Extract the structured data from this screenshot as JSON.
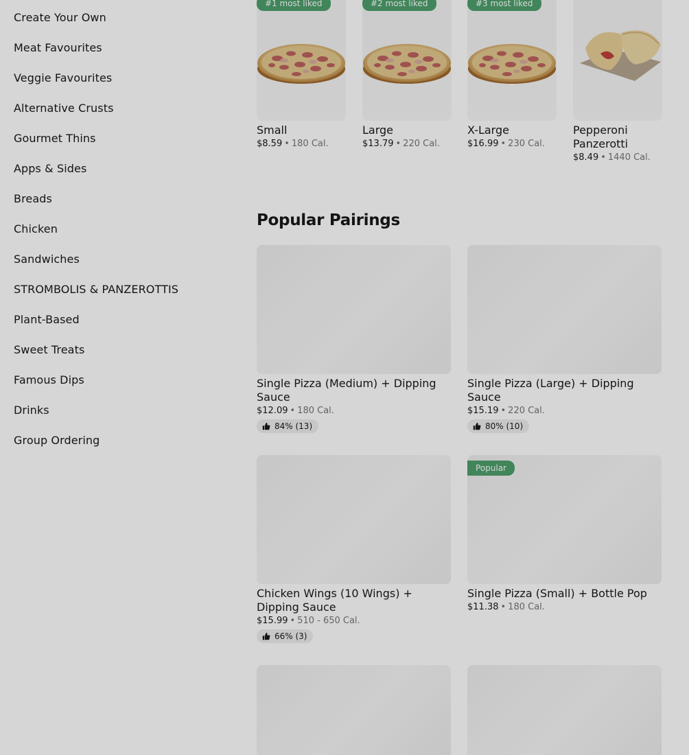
{
  "sidebar": {
    "items": [
      {
        "label": "Create Your Own"
      },
      {
        "label": "Meat Favourites"
      },
      {
        "label": "Veggie Favourites"
      },
      {
        "label": "Alternative Crusts"
      },
      {
        "label": "Gourmet Thins"
      },
      {
        "label": "Apps & Sides"
      },
      {
        "label": "Breads"
      },
      {
        "label": "Chicken"
      },
      {
        "label": "Sandwiches"
      },
      {
        "label": "STROMBOLIS & PANZEROTTIS"
      },
      {
        "label": "Plant-Based"
      },
      {
        "label": "Sweet Treats"
      },
      {
        "label": "Famous Dips"
      },
      {
        "label": "Drinks"
      },
      {
        "label": "Group Ordering"
      }
    ]
  },
  "most_liked": [
    {
      "badge": "#1 most liked",
      "name": "Small",
      "price": "$8.59",
      "sep": "•",
      "cal": "180 Cal.",
      "image": "pizza"
    },
    {
      "badge": "#2 most liked",
      "name": "Large",
      "price": "$13.79",
      "sep": "•",
      "cal": "220 Cal.",
      "image": "pizza"
    },
    {
      "badge": "#3 most liked",
      "name": "X-Large",
      "price": "$16.99",
      "sep": "•",
      "cal": "230 Cal.",
      "image": "pizza"
    },
    {
      "badge": "",
      "name": "Pepperoni Panzerotti",
      "price": "$8.49",
      "sep": "•",
      "cal": "1440 Cal.",
      "image": "panzerotti"
    }
  ],
  "pairings": {
    "title": "Popular Pairings",
    "items": [
      {
        "name": "Single Pizza (Medium) + Dipping Sauce",
        "price": "$12.09",
        "sep": "•",
        "cal": "180 Cal.",
        "rating": "84% (13)",
        "badge": ""
      },
      {
        "name": "Single Pizza (Large) + Dipping Sauce",
        "price": "$15.19",
        "sep": "•",
        "cal": "220 Cal.",
        "rating": "80% (10)",
        "badge": ""
      },
      {
        "name": "Chicken Wings (10 Wings) + Dipping Sauce",
        "price": "$15.99",
        "sep": "•",
        "cal": "510 - 650 Cal.",
        "rating": "66% (3)",
        "badge": ""
      },
      {
        "name": "Single Pizza (Small) + Bottle Pop",
        "price": "$11.38",
        "sep": "•",
        "cal": "180 Cal.",
        "rating": "",
        "badge": "Popular"
      }
    ]
  },
  "colors": {
    "badge_green": "#4e9f6c",
    "text_primary": "#191919",
    "text_secondary": "#767676",
    "overlay": "rgba(0,0,0,0.16)"
  },
  "icons": {
    "thumbs_up": "thumbs-up-icon"
  }
}
